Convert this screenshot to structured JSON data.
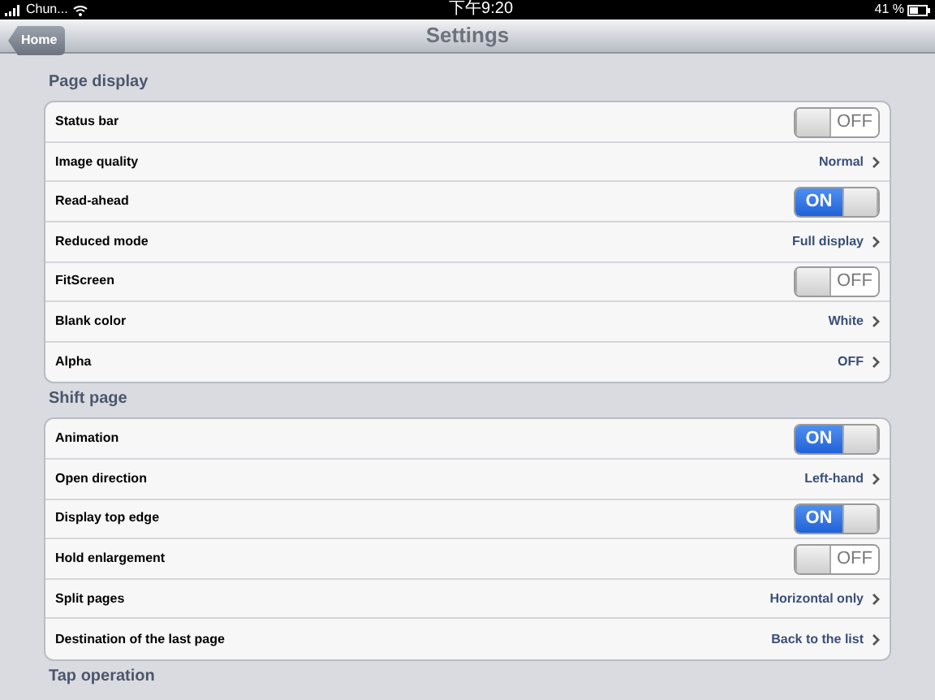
{
  "status_bar": {
    "carrier": "Chun...",
    "time": "下午9:20",
    "battery": "41 %"
  },
  "nav": {
    "back": "Home",
    "title": "Settings"
  },
  "sections": [
    {
      "title": "Page display",
      "rows": [
        {
          "kind": "toggle",
          "label": "Status bar",
          "on": false,
          "text": "OFF"
        },
        {
          "kind": "link",
          "label": "Image quality",
          "value": "Normal"
        },
        {
          "kind": "toggle",
          "label": "Read-ahead",
          "on": true,
          "text": "ON"
        },
        {
          "kind": "link",
          "label": "Reduced mode",
          "value": "Full display"
        },
        {
          "kind": "toggle",
          "label": "FitScreen",
          "on": false,
          "text": "OFF"
        },
        {
          "kind": "link",
          "label": "Blank color",
          "value": "White"
        },
        {
          "kind": "link",
          "label": "Alpha",
          "value": "OFF"
        }
      ]
    },
    {
      "title": "Shift page",
      "rows": [
        {
          "kind": "toggle",
          "label": "Animation",
          "on": true,
          "text": "ON"
        },
        {
          "kind": "link",
          "label": "Open direction",
          "value": "Left-hand"
        },
        {
          "kind": "toggle",
          "label": "Display top edge",
          "on": true,
          "text": "ON"
        },
        {
          "kind": "toggle",
          "label": "Hold enlargement",
          "on": false,
          "text": "OFF"
        },
        {
          "kind": "link",
          "label": "Split pages",
          "value": "Horizontal only"
        },
        {
          "kind": "link",
          "label": "Destination of the last page",
          "value": "Back to the list"
        }
      ]
    },
    {
      "title": "Tap operation"
    }
  ]
}
